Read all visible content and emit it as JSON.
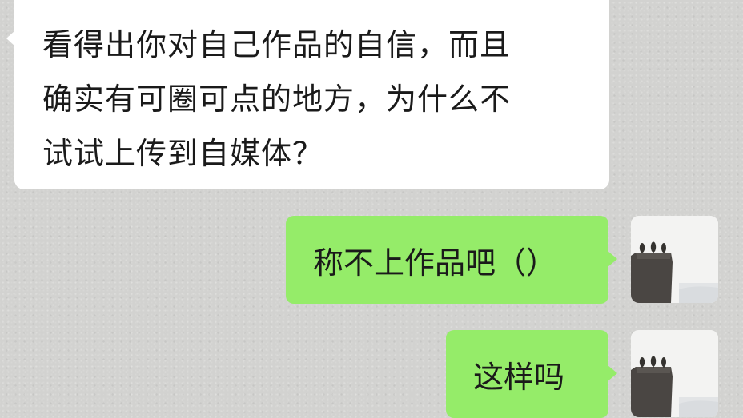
{
  "chat": {
    "messages": [
      {
        "sender": "other",
        "lines": [
          "看得出你对自己作品的自信，而且",
          "确实有可圈可点的地方，为什么不",
          "试试上传到自媒体？"
        ]
      },
      {
        "sender": "self",
        "text": "称不上作品吧（）"
      },
      {
        "sender": "self",
        "text": "这样吗"
      }
    ]
  },
  "colors": {
    "incoming_bubble": "#ffffff",
    "outgoing_bubble": "#95ec69",
    "background": "#d2d2d0"
  },
  "avatar": {
    "icon": "cliff-trees-moon-avatar"
  }
}
